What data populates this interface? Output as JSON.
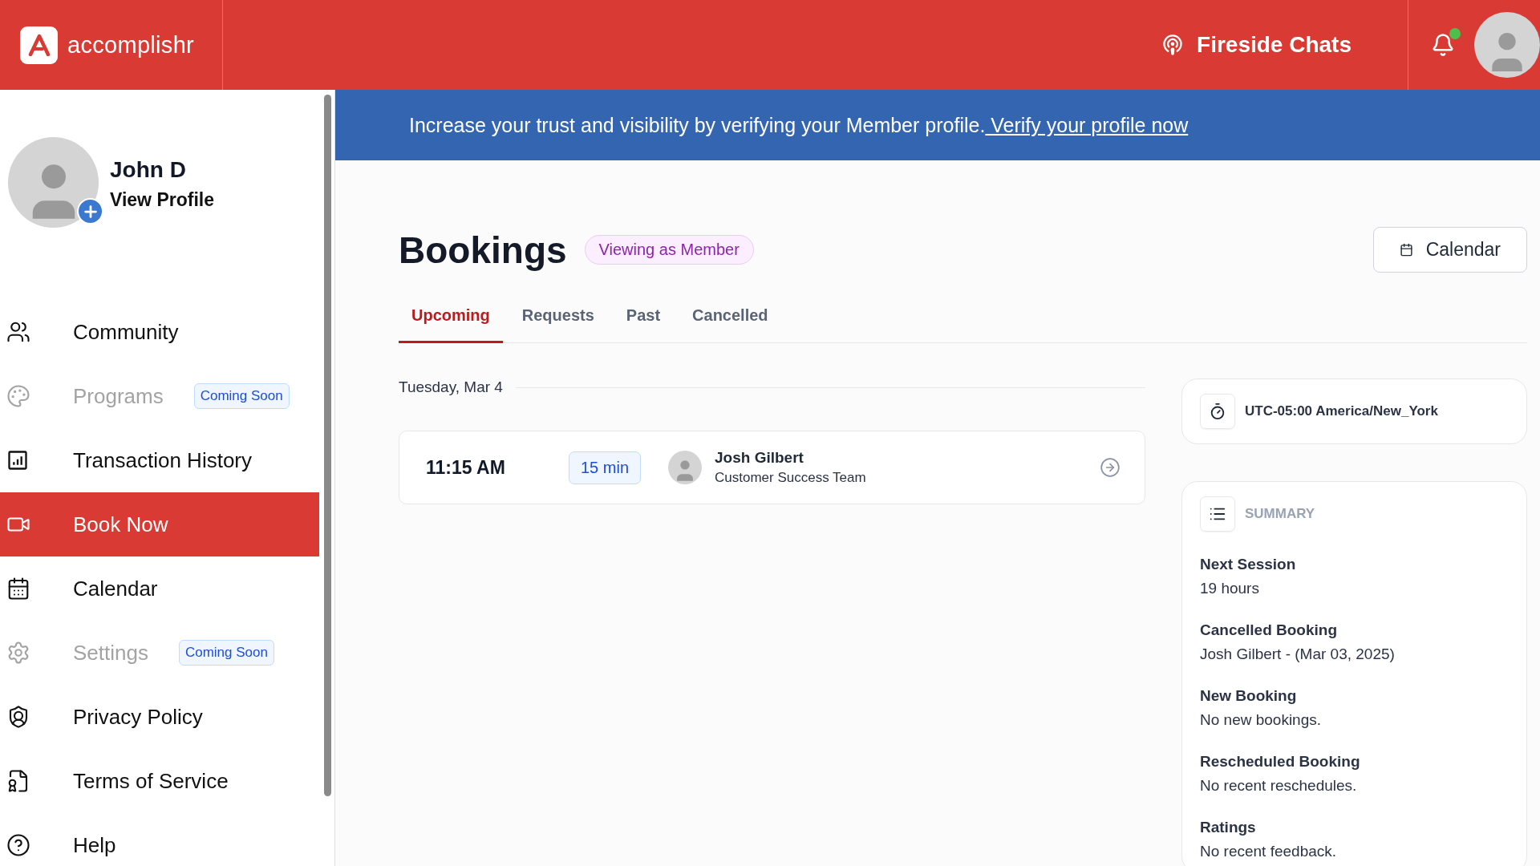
{
  "header": {
    "logo_text": "accomplishr",
    "link": "Fireside Chats",
    "notifications": {
      "unread": true
    }
  },
  "profile": {
    "name": "John D",
    "link": "View Profile"
  },
  "sidebar": {
    "items": [
      {
        "label": "Community",
        "disabled": false,
        "selected": false
      },
      {
        "label": "Programs",
        "disabled": true,
        "selected": false,
        "badge": "Coming Soon"
      },
      {
        "label": "Transaction History",
        "disabled": false,
        "selected": false
      },
      {
        "label": "Book Now",
        "disabled": false,
        "selected": true
      },
      {
        "label": "Calendar",
        "disabled": false,
        "selected": false
      },
      {
        "label": "Settings",
        "disabled": true,
        "selected": false,
        "badge": "Coming Soon"
      },
      {
        "label": "Privacy Policy",
        "disabled": false,
        "selected": false
      },
      {
        "label": "Terms of Service",
        "disabled": false,
        "selected": false
      },
      {
        "label": "Help",
        "disabled": false,
        "selected": false
      }
    ]
  },
  "banner": {
    "text": "Increase your trust and visibility by verifying your Member profile.",
    "link": " Verify your profile now"
  },
  "page": {
    "title": "Bookings",
    "badge": "Viewing as Member",
    "calendar_button": "Calendar",
    "tabs": [
      {
        "label": "Upcoming",
        "selected": true
      },
      {
        "label": "Requests",
        "selected": false
      },
      {
        "label": "Past",
        "selected": false
      },
      {
        "label": "Cancelled",
        "selected": false
      }
    ],
    "groups": [
      {
        "date": "Tuesday, Mar 4",
        "bookings": [
          {
            "time": "11:15 AM",
            "duration": "15 min",
            "name": "Josh Gilbert",
            "team": "Customer Success Team"
          }
        ]
      }
    ],
    "timezone": "UTC-05:00 America/New_York",
    "summary": {
      "title": "SUMMARY",
      "items": [
        {
          "label": "Next Session",
          "value": "19 hours"
        },
        {
          "label": "Cancelled Booking",
          "value": "Josh Gilbert - (Mar 03, 2025)"
        },
        {
          "label": "New Booking",
          "value": "No new bookings."
        },
        {
          "label": "Rescheduled Booking",
          "value": "No recent reschedules."
        },
        {
          "label": "Ratings",
          "value": "No recent feedback."
        }
      ]
    }
  }
}
